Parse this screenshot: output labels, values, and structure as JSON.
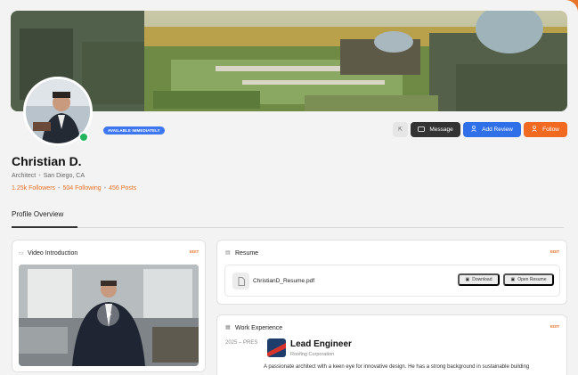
{
  "profile": {
    "availability": "AVAILABLE IMMEDIATELY",
    "name": "Christian D.",
    "title": "Architect",
    "location": "San Diego, CA",
    "followers": "1.25k Followers",
    "following": "504 Following",
    "posts": "456 Posts"
  },
  "actions": {
    "share_icon": "share-icon",
    "message_label": "Message",
    "review_label": "Add Review",
    "follow_label": "Follow"
  },
  "section": {
    "title": "Profile Overview"
  },
  "video_card": {
    "title": "Video Introduction",
    "edit": "EDIT"
  },
  "resume_card": {
    "title": "Resume",
    "edit": "EDIT",
    "file_name": "ChristianD_Resume.pdf",
    "download_label": "Download",
    "open_label": "Open Resume"
  },
  "experience_card": {
    "title": "Work Experience",
    "edit": "EDIT",
    "date": "2025 – PRES",
    "role": "Lead Engineer",
    "company": "Roofing Corporation",
    "description": "A passionate architect with a keen eye for innovative design. He has a strong background in sustainable building"
  },
  "colors": {
    "accent": "#e8742a",
    "primary_blue": "#2f6fe8",
    "dark": "#333333",
    "online": "#22b45a"
  }
}
